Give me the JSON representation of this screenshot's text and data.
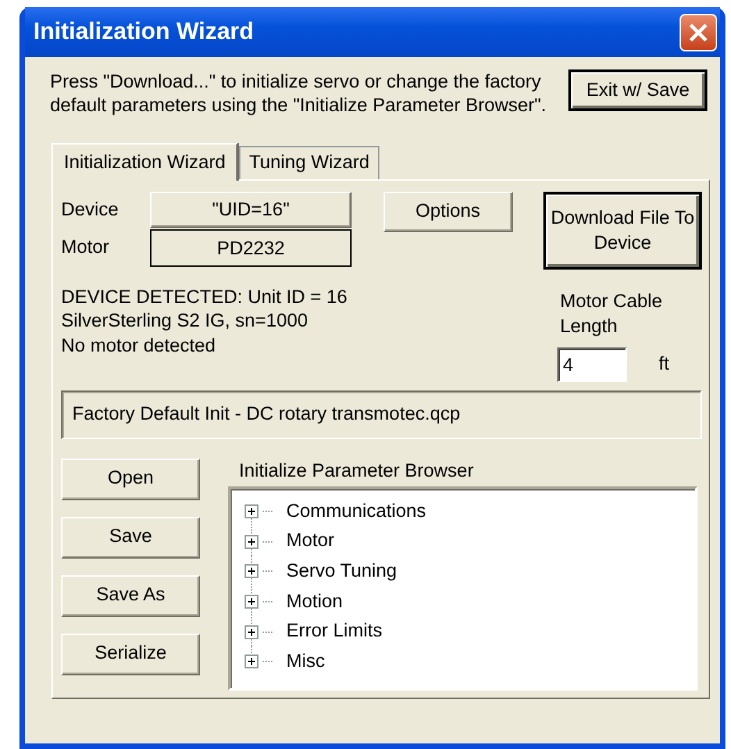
{
  "window": {
    "title": "Initialization Wizard"
  },
  "instructions": "Press \"Download...\" to initialize servo or change the factory default parameters using the \"Initialize Parameter Browser\".",
  "exit_button": "Exit w/ Save",
  "tabs": [
    {
      "label": "Initialization Wizard",
      "selected": true
    },
    {
      "label": "Tuning Wizard",
      "selected": false
    }
  ],
  "device": {
    "label": "Device",
    "value": "\"UID=16\""
  },
  "options_button": "Options",
  "motor": {
    "label": "Motor",
    "value": "PD2232"
  },
  "download_button": "Download File To Device",
  "status_lines": [
    "DEVICE DETECTED: Unit ID = 16",
    "SilverSterling S2 IG, sn=1000",
    "No motor detected"
  ],
  "cable_length": {
    "label": "Motor Cable Length",
    "value": "4",
    "unit": "ft"
  },
  "file_name": "Factory Default Init - DC rotary transmotec.qcp",
  "file_buttons": [
    "Open",
    "Save",
    "Save As",
    "Serialize"
  ],
  "browser": {
    "title": "Initialize Parameter Browser",
    "items": [
      {
        "label": "Communications",
        "expanded": false
      },
      {
        "label": "Motor",
        "expanded": false
      },
      {
        "label": "Servo Tuning",
        "expanded": false
      },
      {
        "label": "Motion",
        "expanded": false
      },
      {
        "label": "Error Limits",
        "expanded": false
      },
      {
        "label": "Misc",
        "expanded": false
      }
    ]
  }
}
